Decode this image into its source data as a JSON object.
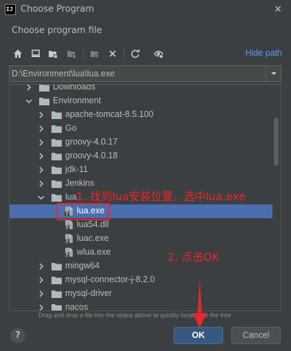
{
  "window": {
    "logo_text": "IJ",
    "title": "Choose Program",
    "close_glyph": "✕"
  },
  "dialog": {
    "subtitle": "Choose program file",
    "hide_path_label": "Hide path",
    "path_value": "D:\\Environment\\lua\\lua.exe",
    "hint": "Drag and drop a file into the space above to quickly locate it in the tree",
    "help_label": "?",
    "ok_label": "OK",
    "cancel_label": "Cancel"
  },
  "toolbar": {
    "icons": [
      "home-icon",
      "desktop-icon",
      "project-folder-icon",
      "module-folder-icon",
      "new-folder-icon",
      "delete-icon",
      "refresh-icon",
      "show-hidden-icon"
    ]
  },
  "tree": {
    "items": [
      {
        "label": "Downloads",
        "type": "folder",
        "level": 1,
        "expanded": false
      },
      {
        "label": "Environment",
        "type": "folder",
        "level": 1,
        "expanded": true
      },
      {
        "label": "apache-tomcat-8.5.100",
        "type": "folder",
        "level": 2,
        "expanded": false
      },
      {
        "label": "Go",
        "type": "folder",
        "level": 2,
        "expanded": false
      },
      {
        "label": "groovy-4.0.17",
        "type": "folder",
        "level": 2,
        "expanded": false
      },
      {
        "label": "groovy-4.0.18",
        "type": "folder",
        "level": 2,
        "expanded": false
      },
      {
        "label": "jdk-11",
        "type": "folder",
        "level": 2,
        "expanded": false
      },
      {
        "label": "Jenkins",
        "type": "folder",
        "level": 2,
        "expanded": false
      },
      {
        "label": "lua",
        "type": "folder",
        "level": 2,
        "expanded": true
      },
      {
        "label": "lua.exe",
        "type": "file",
        "level": 3,
        "selected": true
      },
      {
        "label": "lua54.dll",
        "type": "file",
        "level": 3
      },
      {
        "label": "luac.exe",
        "type": "file",
        "level": 3
      },
      {
        "label": "wlua.exe",
        "type": "file",
        "level": 3
      },
      {
        "label": "mingw64",
        "type": "folder",
        "level": 2,
        "expanded": false
      },
      {
        "label": "mysql-connector-j-8.2.0",
        "type": "folder",
        "level": 2,
        "expanded": false
      },
      {
        "label": "mysql-driver",
        "type": "folder",
        "level": 2,
        "expanded": false
      },
      {
        "label": "nacos",
        "type": "folder",
        "level": 2,
        "expanded": false
      }
    ]
  },
  "annotations": {
    "step1": "1. 找到lua安装位置，选中lua.exe",
    "step2": "2. 点击OK"
  },
  "colors": {
    "background": "#3c3f41",
    "selection": "#4b6eaf",
    "link": "#589df6",
    "ok_button": "#365880",
    "annotation": "#e8262b",
    "folder": "#aeb9c0"
  }
}
